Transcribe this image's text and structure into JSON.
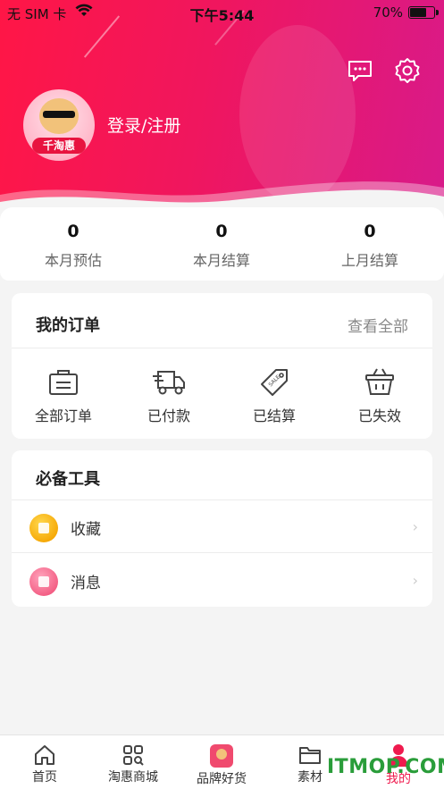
{
  "status_bar": {
    "carrier": "无 SIM 卡",
    "time": "下午5:44",
    "battery_percent": "70%",
    "battery_level": 0.7
  },
  "header": {
    "login_label": "登录/注册",
    "avatar_text": "千淘惠",
    "gradient_start": "#ff1646",
    "gradient_end": "#d81a8a"
  },
  "stats": [
    {
      "value": "0",
      "label": "本月预估"
    },
    {
      "value": "0",
      "label": "本月结算"
    },
    {
      "value": "0",
      "label": "上月结算"
    }
  ],
  "orders": {
    "title": "我的订单",
    "view_all": "查看全部",
    "items": [
      {
        "label": "全部订单",
        "icon": "bag-icon"
      },
      {
        "label": "已付款",
        "icon": "truck-icon"
      },
      {
        "label": "已结算",
        "icon": "sale-tag-icon"
      },
      {
        "label": "已失效",
        "icon": "basket-icon"
      }
    ]
  },
  "tools": {
    "title": "必备工具",
    "items": [
      {
        "label": "收藏",
        "icon": "favorite-icon"
      },
      {
        "label": "消息",
        "icon": "message-icon"
      }
    ]
  },
  "tab_bar": {
    "active_color": "#ef1a4e",
    "items": [
      {
        "label": "首页",
        "icon": "home-icon"
      },
      {
        "label": "淘惠商城",
        "icon": "grid-search-icon"
      },
      {
        "label": "品牌好货",
        "icon": "brand-icon"
      },
      {
        "label": "素材",
        "icon": "folder-icon"
      },
      {
        "label": "我的",
        "icon": "person-icon",
        "active": true
      }
    ]
  },
  "watermark": "ITMOP.COM"
}
